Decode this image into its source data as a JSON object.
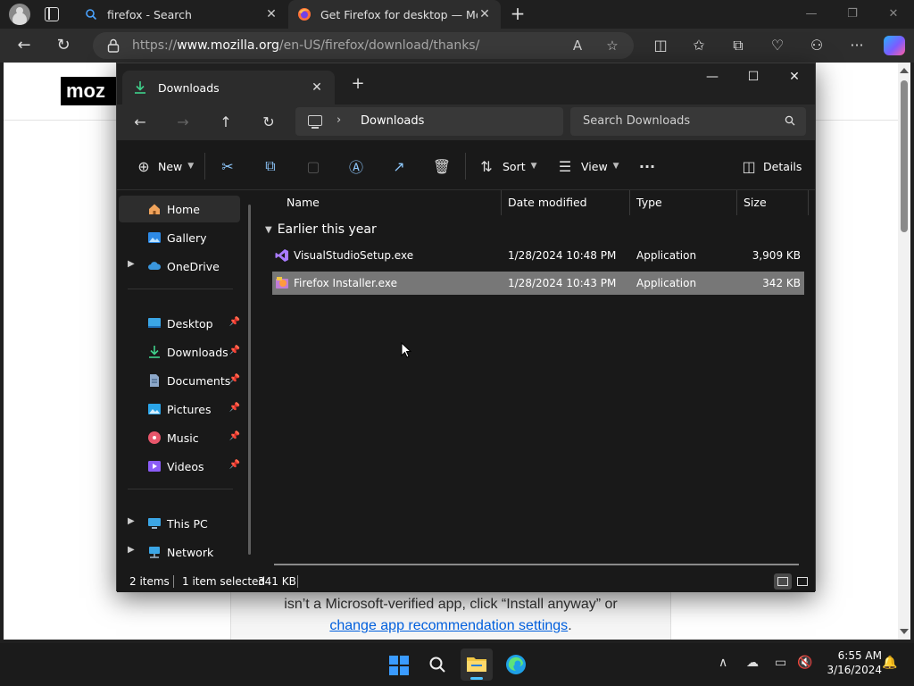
{
  "browser": {
    "tabs": [
      {
        "title": "firefox - Search",
        "active": false
      },
      {
        "title": "Get Firefox for desktop — Mozill",
        "active": true
      }
    ],
    "url_prefix": "https://",
    "url_domain": "www.mozilla.org",
    "url_path": "/en-US/firefox/download/thanks/",
    "page": {
      "logo_text": "moz",
      "body_line": "isn’t a Microsoft-verified app, click “Install anyway” or",
      "link_text": "change app recommendation settings",
      "link_suffix": "."
    }
  },
  "explorer": {
    "tab_title": "Downloads",
    "location": "Downloads",
    "search_placeholder": "Search Downloads",
    "commands": {
      "new": "New",
      "sort": "Sort",
      "view": "View",
      "details": "Details"
    },
    "sidebar": [
      {
        "label": "Home",
        "icon": "home-icon",
        "selected": true
      },
      {
        "label": "Gallery",
        "icon": "gallery-icon"
      },
      {
        "label": "OneDrive",
        "icon": "cloud-icon",
        "expandable": true
      },
      {
        "label": "Desktop",
        "icon": "desktop-icon",
        "pinned": true
      },
      {
        "label": "Downloads",
        "icon": "download-icon",
        "pinned": true
      },
      {
        "label": "Documents",
        "icon": "document-icon",
        "pinned": true
      },
      {
        "label": "Pictures",
        "icon": "pictures-icon",
        "pinned": true
      },
      {
        "label": "Music",
        "icon": "music-icon",
        "pinned": true
      },
      {
        "label": "Videos",
        "icon": "videos-icon",
        "pinned": true
      },
      {
        "label": "This PC",
        "icon": "pc-icon",
        "expandable": true
      },
      {
        "label": "Network",
        "icon": "network-icon",
        "expandable": true
      }
    ],
    "columns": [
      "Name",
      "Date modified",
      "Type",
      "Size"
    ],
    "group": "Earlier this year",
    "files": [
      {
        "name": "VisualStudioSetup.exe",
        "date": "1/28/2024 10:48 PM",
        "type": "Application",
        "size": "3,909 KB",
        "selected": false
      },
      {
        "name": "Firefox Installer.exe",
        "date": "1/28/2024 10:43 PM",
        "type": "Application",
        "size": "342 KB",
        "selected": true
      }
    ],
    "status": {
      "count": "2 items",
      "selection": "1 item selected",
      "size": "341 KB"
    }
  },
  "taskbar": {
    "time": "6:55 AM",
    "date": "3/16/2024"
  },
  "colors": {
    "accent": "#4cc2ff",
    "selected_row": "#777777",
    "link": "#0060df"
  }
}
